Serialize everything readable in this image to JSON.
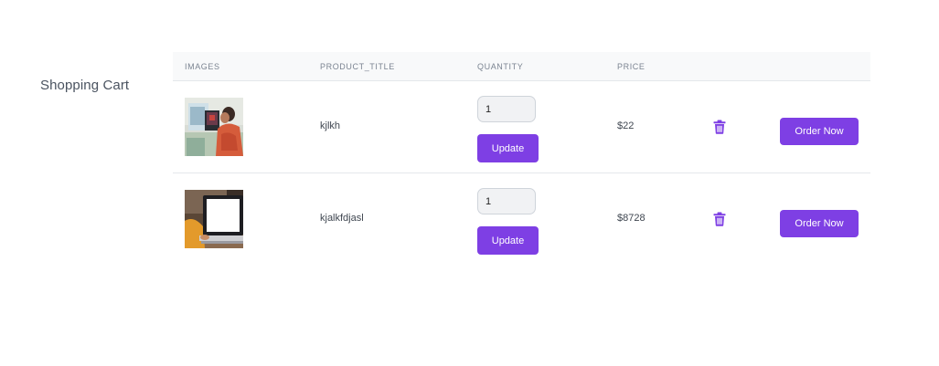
{
  "page": {
    "title": "Shopping Cart"
  },
  "table": {
    "headers": {
      "images": "IMAGES",
      "product_title": "PRODUCT_TITLE",
      "quantity": "QUANTITY",
      "price": "PRICE"
    },
    "rows": [
      {
        "image_icon": "product-photo-woman-tablet",
        "title": "kjlkh",
        "quantity": "1",
        "update_label": "Update",
        "price": "$22",
        "delete_icon": "trash-icon",
        "order_label": "Order Now"
      },
      {
        "image_icon": "product-photo-laptop",
        "title": "kjalkfdjasl",
        "quantity": "1",
        "update_label": "Update",
        "price": "$8728",
        "delete_icon": "trash-icon",
        "order_label": "Order Now"
      }
    ]
  },
  "colors": {
    "accent": "#7e3fe4",
    "header_bg": "#f8f9fa",
    "divider": "#e4e7eb"
  }
}
